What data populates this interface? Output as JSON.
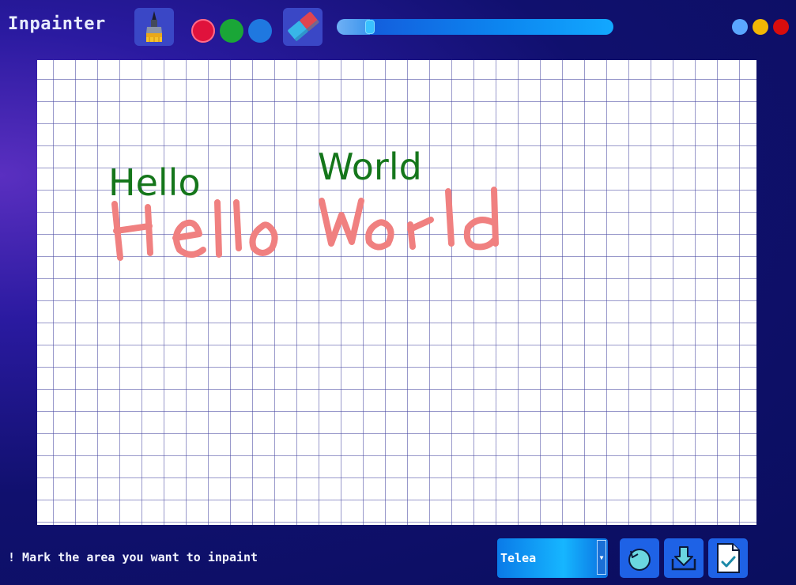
{
  "app": {
    "title": "Inpainter"
  },
  "toolbar": {
    "tools": [
      {
        "name": "brush",
        "icon": "paintbrush-icon"
      },
      {
        "name": "eraser",
        "icon": "eraser-icon"
      }
    ],
    "colors": [
      {
        "name": "red",
        "hex": "#e0123c",
        "selected": true
      },
      {
        "name": "green",
        "hex": "#1aa637",
        "selected": false
      },
      {
        "name": "blue",
        "hex": "#1f78e0",
        "selected": false
      }
    ],
    "brush_size_slider": {
      "value_fraction": 0.12
    }
  },
  "window_controls": [
    {
      "name": "minimize",
      "hex": "#5aa6ff"
    },
    {
      "name": "maximize",
      "hex": "#f2b705"
    },
    {
      "name": "close",
      "hex": "#d90d0d"
    }
  ],
  "canvas": {
    "grid": true,
    "text_items": [
      {
        "text": "Hello",
        "color": "#15761b"
      },
      {
        "text": "World",
        "color": "#15761b"
      }
    ],
    "mask_strokes": {
      "color": "#f08080",
      "text": "Hello World"
    }
  },
  "footer": {
    "status": "! Mark the area you want to inpaint",
    "method_select": {
      "value": "Telea"
    },
    "buttons": [
      {
        "name": "reset",
        "icon": "refresh-icon"
      },
      {
        "name": "save",
        "icon": "download-icon"
      },
      {
        "name": "apply",
        "icon": "file-check-icon"
      }
    ]
  }
}
